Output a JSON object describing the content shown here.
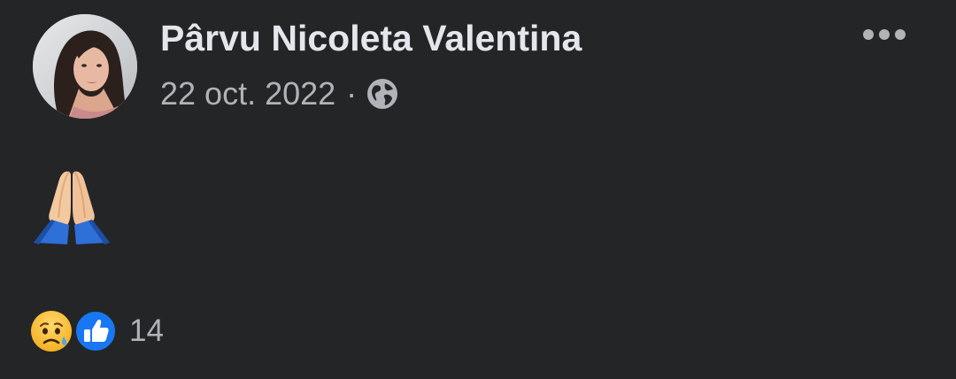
{
  "post": {
    "author_name": "Pârvu Nicoleta Valentina",
    "date": "22 oct. 2022",
    "separator": "·",
    "audience_icon": "globe-icon",
    "menu_icon": "more-options-icon",
    "message_emoji": "folded-hands-emoji"
  },
  "reactions": {
    "icons": [
      "sad-reaction-icon",
      "like-reaction-icon"
    ],
    "count": "14"
  },
  "colors": {
    "background": "#242527",
    "name_text": "#e4e6eb",
    "secondary_text": "#b0b3b8",
    "like_blue": "#1877f2"
  }
}
